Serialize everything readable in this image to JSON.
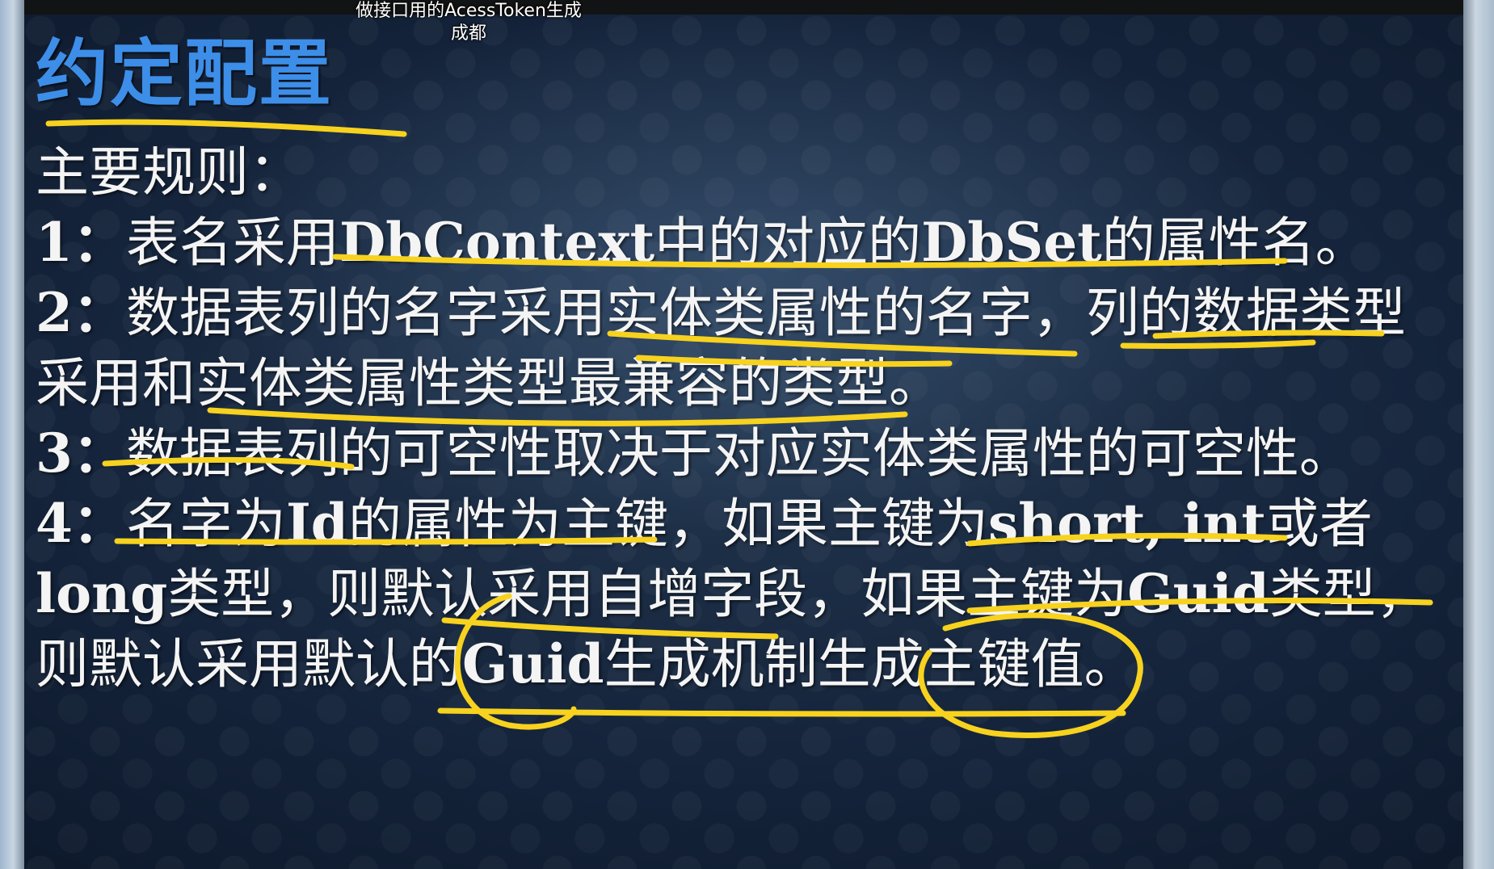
{
  "caption": {
    "line1": "做接口用的AcessToken生成",
    "line2": "成都"
  },
  "slide": {
    "title": "约定配置",
    "heading": "主要规则：",
    "rules": [
      {
        "num": "1：",
        "p1": "表名采用",
        "b1": "DbContext",
        "p2": "中的对应的",
        "b2": "DbSet",
        "p3": "的属性名。"
      },
      {
        "num": "2：",
        "p1": "数据表列的名字采用实体类属性的名字，列的数据类型",
        "p2": "采用和实体类属性类型最兼容的类型。"
      },
      {
        "num": "3：",
        "p1": "数据表列的可空性取决于对应实体类属性的可空性。"
      },
      {
        "num": "4：",
        "p1": "名字为",
        "b1": "Id",
        "p2": "的属性为主键，如果主键为",
        "b2": "short, int",
        "p3": "或者",
        "b3": "long",
        "p4": "类型，则默认采用自增字段，如果主键为",
        "b4": "Guid",
        "p5": "类型，",
        "p6": "则默认采用默认的",
        "b5": "Guid",
        "p7": "生成机制生成主键值。"
      }
    ]
  },
  "annotation": {
    "ink_color": "#f7d21e"
  }
}
